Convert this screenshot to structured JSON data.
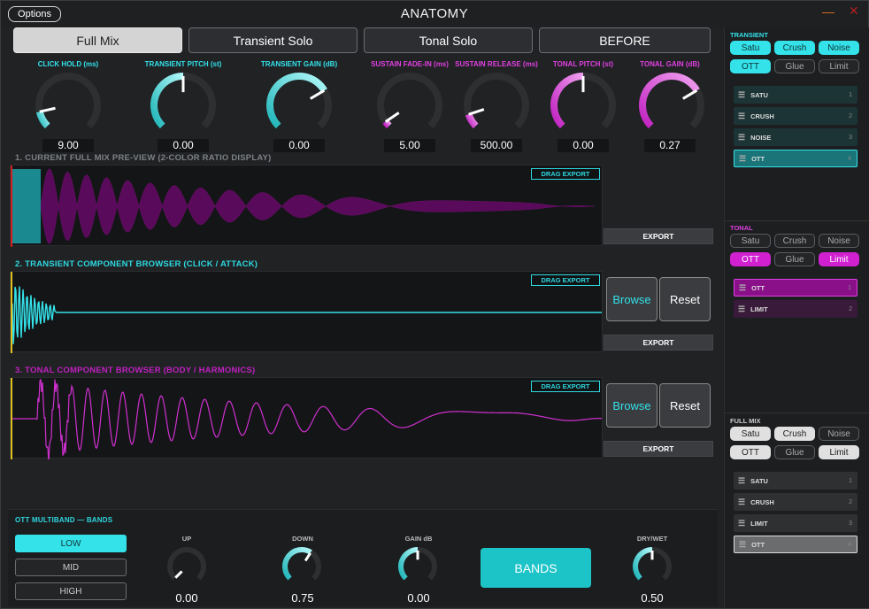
{
  "window": {
    "title": "ANATOMY",
    "options_label": "Options",
    "minimize_glyph": "—",
    "close_glyph": "✕"
  },
  "mode_tabs": [
    {
      "label": "Full Mix",
      "active": true
    },
    {
      "label": "Transient Solo",
      "active": false
    },
    {
      "label": "Tonal Solo",
      "active": false
    },
    {
      "label": "BEFORE",
      "active": false
    }
  ],
  "knobs": [
    {
      "label": "CLICK HOLD (ms)",
      "value": "9.00",
      "color": "#1fb5b8",
      "fraction": 0.12
    },
    {
      "label": "TRANSIENT PITCH (st)",
      "value": "0.00",
      "color": "#1fb5b8",
      "fraction": 0.5
    },
    {
      "label": "TRANSIENT GAIN (dB)",
      "value": "0.00",
      "color": "#1fb5b8",
      "fraction": 0.72
    },
    {
      "label": "SUSTAIN FADE-IN (ms)",
      "value": "5.00",
      "color": "#c020c0",
      "fraction": 0.04
    },
    {
      "label": "SUSTAIN RELEASE (ms)",
      "value": "500.00",
      "color": "#c020c0",
      "fraction": 0.1
    },
    {
      "label": "TONAL PITCH (st)",
      "value": "0.00",
      "color": "#c020c0",
      "fraction": 0.5
    },
    {
      "label": "TONAL GAIN (dB)",
      "value": "0.27",
      "color": "#c020c0",
      "fraction": 0.72
    }
  ],
  "sections": {
    "full_mix": {
      "title": "1. CURRENT FULL MIX PRE-VIEW (2-COLOR RATIO DISPLAY)",
      "drag_export": "DRAG EXPORT",
      "export": "EXPORT"
    },
    "transient": {
      "title": "2. TRANSIENT COMPONENT BROWSER (CLICK / ATTACK)",
      "drag_export": "DRAG EXPORT",
      "export": "EXPORT",
      "browse": "Browse",
      "reset": "Reset"
    },
    "tonal": {
      "title": "3. TONAL COMPONENT BROWSER (BODY / HARMONICS)",
      "drag_export": "DRAG EXPORT",
      "export": "EXPORT",
      "browse": "Browse",
      "reset": "Reset"
    }
  },
  "right_panel": {
    "transient": {
      "title": "TRANSIENT",
      "fx": [
        {
          "label": "Satu",
          "on": true
        },
        {
          "label": "Crush",
          "on": true
        },
        {
          "label": "Noise",
          "on": true
        },
        {
          "label": "OTT",
          "on": true
        },
        {
          "label": "Glue",
          "on": false
        },
        {
          "label": "Limit",
          "on": false
        }
      ],
      "chain": [
        {
          "label": "SATU",
          "index": "1",
          "selected": false
        },
        {
          "label": "CRUSH",
          "index": "2",
          "selected": false
        },
        {
          "label": "NOISE",
          "index": "3",
          "selected": false
        },
        {
          "label": "OTT",
          "index": "4",
          "selected": true
        }
      ]
    },
    "tonal": {
      "title": "TONAL",
      "fx": [
        {
          "label": "Satu",
          "on": false
        },
        {
          "label": "Crush",
          "on": false
        },
        {
          "label": "Noise",
          "on": false
        },
        {
          "label": "OTT",
          "on": true
        },
        {
          "label": "Glue",
          "on": false
        },
        {
          "label": "Limit",
          "on": true
        }
      ],
      "chain": [
        {
          "label": "OTT",
          "index": "1",
          "selected": true
        },
        {
          "label": "LIMIT",
          "index": "2",
          "selected": false
        }
      ]
    },
    "full_mix": {
      "title": "FULL MIX",
      "fx": [
        {
          "label": "Satu",
          "on": true
        },
        {
          "label": "Crush",
          "on": true
        },
        {
          "label": "Noise",
          "on": false
        },
        {
          "label": "OTT",
          "on": true
        },
        {
          "label": "Glue",
          "on": false
        },
        {
          "label": "Limit",
          "on": true
        }
      ],
      "chain": [
        {
          "label": "SATU",
          "index": "1",
          "selected": false
        },
        {
          "label": "CRUSH",
          "index": "2",
          "selected": false
        },
        {
          "label": "LIMIT",
          "index": "3",
          "selected": false
        },
        {
          "label": "OTT",
          "index": "4",
          "selected": true
        }
      ]
    }
  },
  "ott": {
    "title": "OTT MULTIBAND — BANDS",
    "bands": [
      {
        "label": "LOW",
        "active": true
      },
      {
        "label": "MID",
        "active": false
      },
      {
        "label": "HIGH",
        "active": false
      }
    ],
    "knobs": [
      {
        "label": "UP",
        "value": "0.00",
        "fraction": 0.0
      },
      {
        "label": "DOWN",
        "value": "0.75",
        "fraction": 0.62
      },
      {
        "label": "GAIN dB",
        "value": "0.00",
        "fraction": 0.5
      },
      {
        "label": "DRY/WET",
        "value": "0.50",
        "fraction": 0.5
      }
    ],
    "bands_button": "BANDS"
  },
  "colors": {
    "teal": "#1fb5b8",
    "cyan": "#34e2ea",
    "magenta": "#c020c0",
    "purple_wave": "#5a0a5a",
    "track": "#2d2f31"
  }
}
